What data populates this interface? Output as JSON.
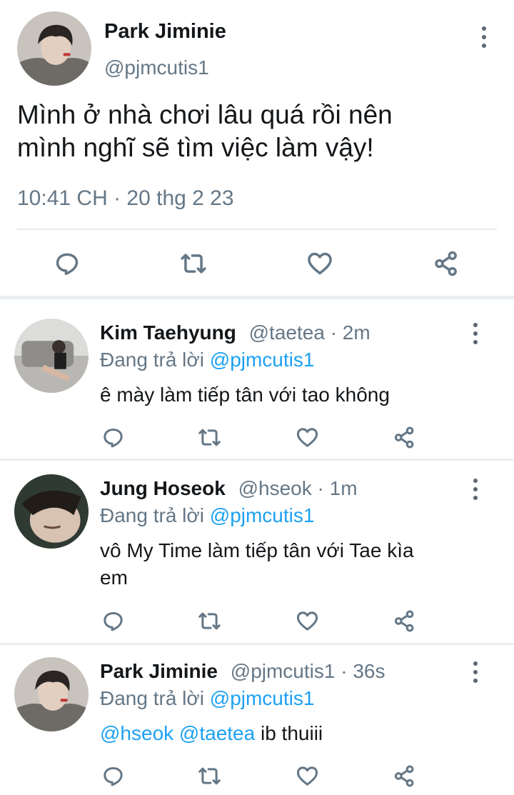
{
  "main_tweet": {
    "name": "Park Jiminie",
    "handle": "@pjmcutis1",
    "text_line1": "Mình ở nhà chơi lâu quá rồi nên",
    "text_line2": "mình nghĩ sẽ tìm việc làm vậy!",
    "timestamp": "10:41 CH · 20 thg 2 23"
  },
  "replies": [
    {
      "name": "Kim Taehyung",
      "handle": "@taetea",
      "time": "· 2m",
      "replying_prefix": "Đang trả lời",
      "replying_to": "@pjmcutis1",
      "text": "ê mày làm tiếp tân với tao không"
    },
    {
      "name": "Jung Hoseok",
      "handle": "@hseok",
      "time": "· 1m",
      "replying_prefix": "Đang trả lời",
      "replying_to": "@pjmcutis1",
      "text_line1": "vô My Time làm tiếp tân với Tae kìa",
      "text_line2": "em"
    },
    {
      "name": "Park Jiminie",
      "handle": "@pjmcutis1",
      "time": "· 36s",
      "replying_prefix": "Đang trả lời",
      "replying_to": "@pjmcutis1",
      "mention1": "@hseok",
      "mention2": "@taetea",
      "text": "ib thuiii"
    }
  ],
  "icons": [
    "more-vertical-icon",
    "reply-icon",
    "retweet-icon",
    "like-icon",
    "share-icon"
  ],
  "colors": {
    "link": "#1da1f2",
    "secondary_text": "#657786",
    "divider": "#ebeef0"
  }
}
